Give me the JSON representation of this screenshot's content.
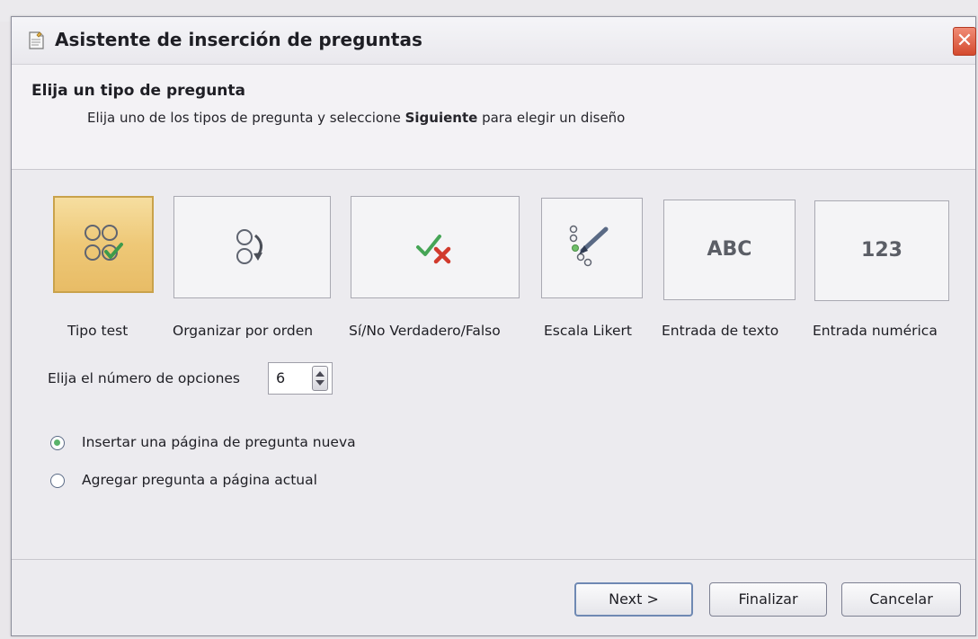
{
  "window": {
    "title": "Asistente de inserción de preguntas",
    "close_glyph": "✕"
  },
  "header": {
    "title": "Elija un tipo de pregunta",
    "subtitle_pre": "Elija uno de los tipos de pregunta y seleccione ",
    "subtitle_bold": "Siguiente",
    "subtitle_post": " para elegir un diseño"
  },
  "question_types": [
    {
      "label": "Tipo test",
      "icon": "multiple-choice-icon",
      "selected": true
    },
    {
      "label": "Organizar por orden",
      "icon": "rank-order-icon",
      "selected": false
    },
    {
      "label": "Sí/No Verdadero/Falso",
      "icon": "true-false-icon",
      "selected": false
    },
    {
      "label": "Escala Likert",
      "icon": "likert-scale-icon",
      "selected": false
    },
    {
      "label": "Entrada de texto",
      "icon": "text-entry-icon",
      "icon_text": "ABC",
      "selected": false
    },
    {
      "label": "Entrada numérica",
      "icon": "numeric-entry-icon",
      "icon_text": "123",
      "selected": false
    }
  ],
  "options_count": {
    "label": "Elija el número de opciones",
    "value": "6"
  },
  "placement": {
    "options": [
      {
        "label": "Insertar una página de pregunta nueva",
        "checked": true
      },
      {
        "label": "Agregar pregunta a página actual",
        "checked": false
      }
    ]
  },
  "buttons": {
    "next": "Next >",
    "finish": "Finalizar",
    "cancel": "Cancelar"
  },
  "colors": {
    "selected_tile": "#eec877",
    "accent_green": "#5ab36a",
    "close_red": "#d44a2e"
  }
}
